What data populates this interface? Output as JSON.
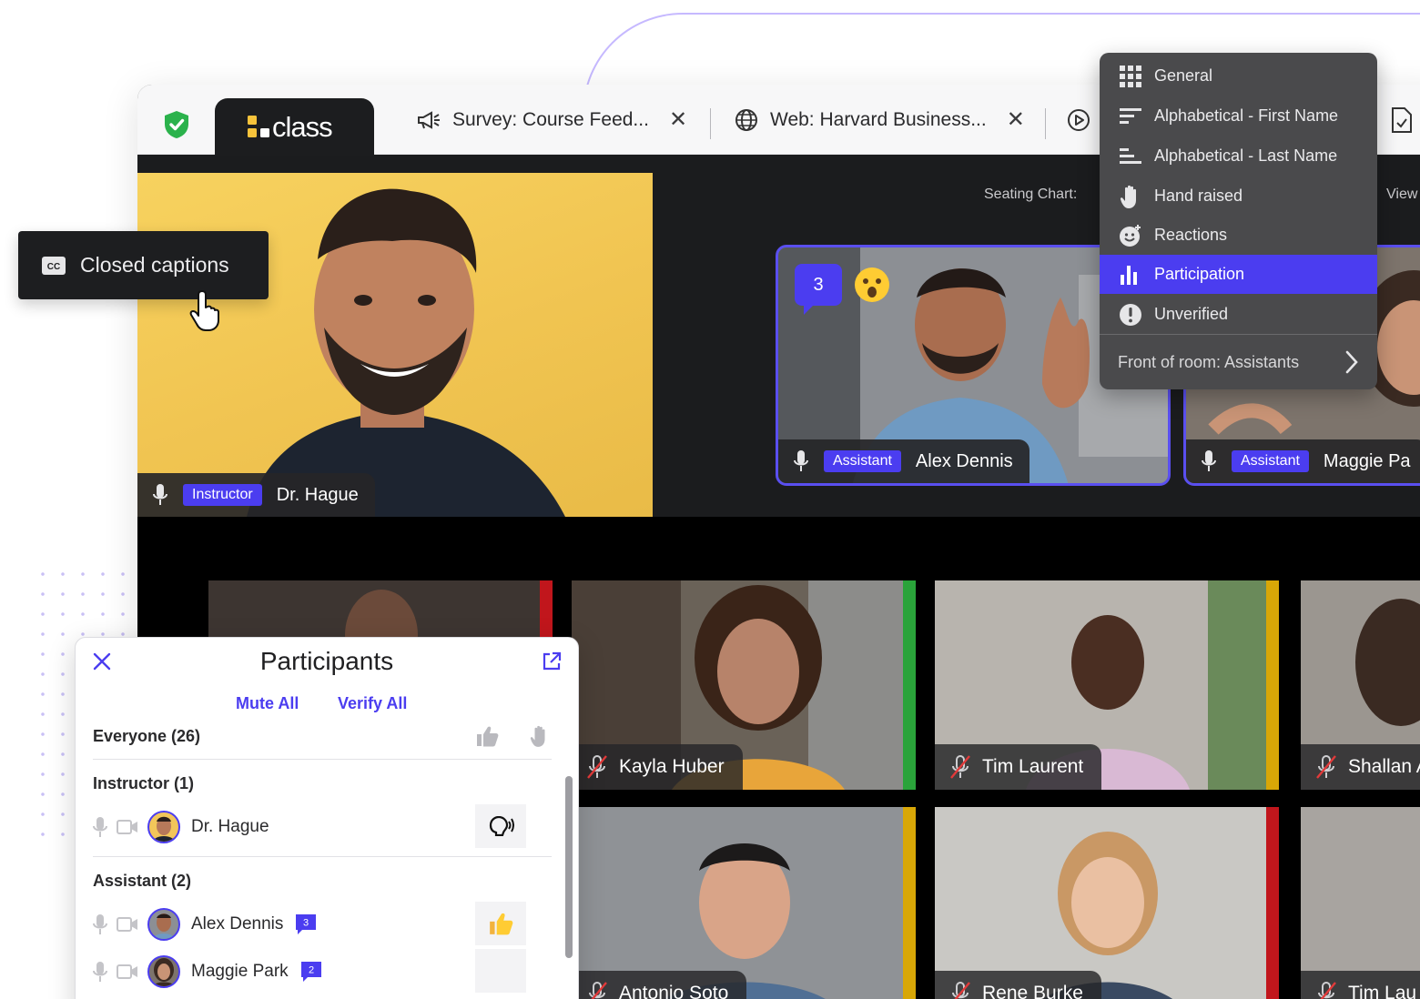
{
  "tabs": {
    "logo": "class",
    "survey": "Survey: Course Feed...",
    "web": "Web: Harvard Business..."
  },
  "seating": {
    "label": "Seating Chart:",
    "view_label": "View"
  },
  "instructor": {
    "role": "Instructor",
    "name": "Dr. Hague"
  },
  "spotlight": [
    {
      "role": "Assistant",
      "name": "Alex Dennis",
      "bubble": "3"
    },
    {
      "role": "Assistant",
      "name": "Maggie Pa"
    }
  ],
  "tooltip": {
    "label": "Closed captions"
  },
  "sort_menu": {
    "items": [
      "General",
      "Alphabetical - First Name",
      "Alphabetical - Last Name",
      "Hand raised",
      "Reactions",
      "Participation",
      "Unverified"
    ],
    "active": "Participation",
    "front": "Front of room: Assistants"
  },
  "grid": [
    {
      "name": "",
      "bar": "#c1161c"
    },
    {
      "name": "Kayla Huber",
      "bar": "#2aa33a"
    },
    {
      "name": "Tim Laurent",
      "bar": "#d8a707"
    },
    {
      "name": "Shallan A",
      "bar": ""
    },
    {
      "name": "Antonio Soto",
      "bar": "#d8a707"
    },
    {
      "name": "Rene Burke",
      "bar": "#c1161c"
    },
    {
      "name": "Tim Lau",
      "bar": ""
    }
  ],
  "participants": {
    "title": "Participants",
    "mute_all": "Mute All",
    "verify_all": "Verify All",
    "everyone": "Everyone (26)",
    "instructor_header": "Instructor (1)",
    "assistant_header": "Assistant (2)",
    "rows": [
      {
        "name": "Dr. Hague"
      },
      {
        "name": "Alex Dennis",
        "badge": "3"
      },
      {
        "name": "Maggie Park",
        "badge": "2"
      }
    ]
  },
  "colors": {
    "accent": "#4b3df0",
    "dark": "#1b1c1e",
    "menu_bg": "#4a4a4c"
  }
}
